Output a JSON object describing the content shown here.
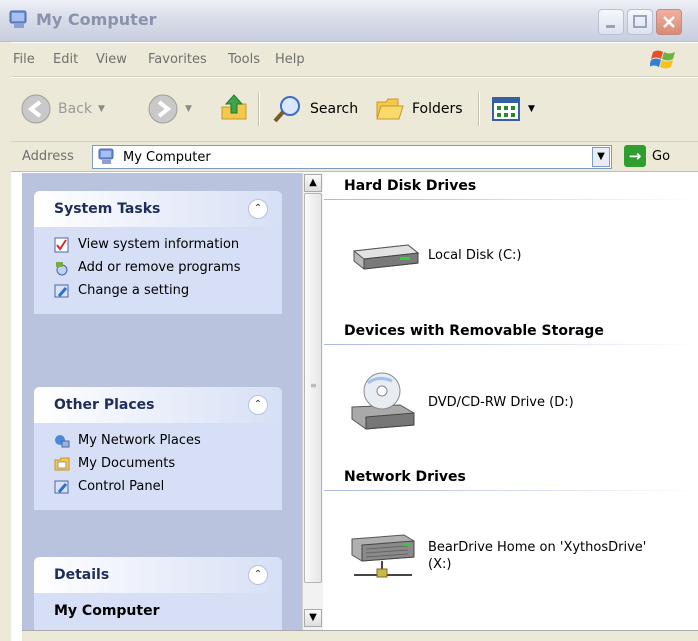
{
  "window": {
    "title": "My Computer",
    "caption_buttons": [
      "minimize",
      "maximize",
      "close"
    ]
  },
  "menu": {
    "items": [
      "File",
      "Edit",
      "View",
      "Favorites",
      "Tools",
      "Help"
    ]
  },
  "toolbar": {
    "back_label": "Back",
    "search_label": "Search",
    "folders_label": "Folders"
  },
  "address": {
    "label": "Address",
    "value": "My Computer",
    "go_label": "Go"
  },
  "taskpane": {
    "system_tasks": {
      "title": "System Tasks",
      "items": [
        "View system information",
        "Add or remove programs",
        "Change a setting"
      ]
    },
    "other_places": {
      "title": "Other Places",
      "items": [
        "My Network Places",
        "My Documents",
        "Control Panel"
      ]
    },
    "details": {
      "title": "Details",
      "name": "My Computer"
    }
  },
  "content": {
    "groups": [
      {
        "title": "Hard Disk Drives",
        "items": [
          "Local Disk (C:)"
        ]
      },
      {
        "title": "Devices with Removable Storage",
        "items": [
          "DVD/CD-RW Drive (D:)"
        ]
      },
      {
        "title": "Network Drives",
        "items": [
          "BearDrive Home on 'XythosDrive' (X:)"
        ]
      }
    ]
  },
  "colors": {
    "menu_bg": "#ece9d8",
    "taskpane_bg": "#b9c3de",
    "panel_body": "#d6dff5",
    "panel_title": "#1f2d5a"
  }
}
